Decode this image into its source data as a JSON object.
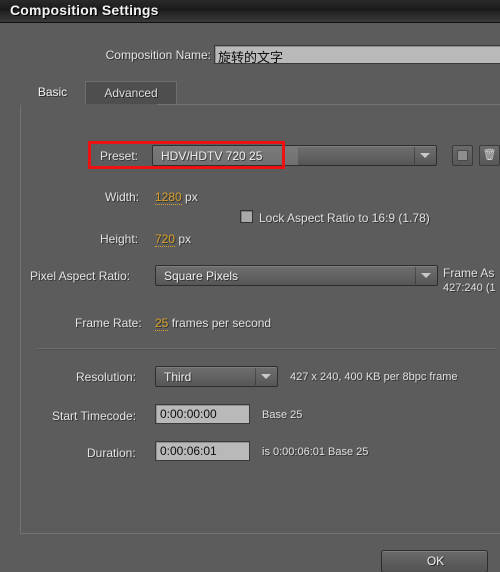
{
  "window": {
    "title": "Composition Settings"
  },
  "composition_name": {
    "label": "Composition Name:",
    "value": "旋转的文字"
  },
  "tabs": [
    {
      "label": "Basic",
      "active": true
    },
    {
      "label": "Advanced",
      "active": false
    }
  ],
  "preset": {
    "label": "Preset:",
    "value": "HDV/HDTV 720 25",
    "save_icon": "save-preset-icon",
    "delete_icon": "trash-icon",
    "delete_glyph": "🗑",
    "highlight_color": "#ee1111"
  },
  "dimensions": {
    "width_label": "Width:",
    "width_value": "1280",
    "width_unit": "px",
    "height_label": "Height:",
    "height_value": "720",
    "height_unit": "px",
    "lock_aspect_label": "Lock Aspect Ratio to 16:9 (1.78)",
    "lock_aspect_checked": false
  },
  "pixel_aspect": {
    "label": "Pixel Aspect Ratio:",
    "value": "Square Pixels"
  },
  "frame_aspect": {
    "label": "Frame As",
    "value": "427:240 (1"
  },
  "frame_rate": {
    "label": "Frame Rate:",
    "value": "25",
    "suffix": "frames per second"
  },
  "resolution": {
    "label": "Resolution:",
    "value": "Third",
    "info": "427 x 240, 400 KB per 8bpc frame"
  },
  "start_timecode": {
    "label": "Start Timecode:",
    "value": "0:00:00:00",
    "suffix": "Base 25"
  },
  "duration": {
    "label": "Duration:",
    "value": "0:00:06:01",
    "suffix": "is 0:00:06:01  Base 25"
  },
  "footer": {
    "ok_label": "OK"
  },
  "colors": {
    "accent_number": "#d8a22a",
    "panel_bg": "#5c5c5c",
    "titlebar_bg": "#1a1a1a"
  }
}
